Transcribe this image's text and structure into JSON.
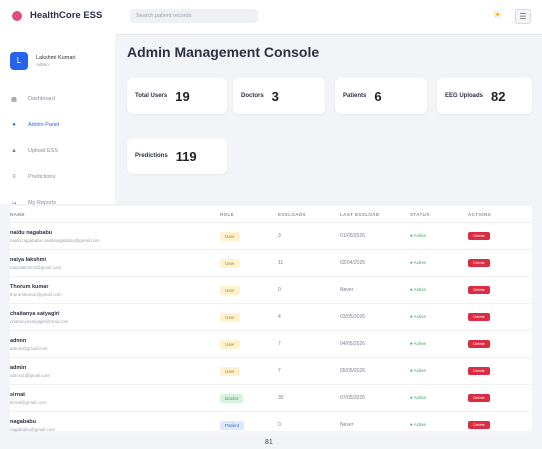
{
  "app": {
    "brand": "HealthCore ESS"
  },
  "search": {
    "placeholder": "Search patient records"
  },
  "user": {
    "initial": "L",
    "name": "Lakshmi Kumari",
    "role": "Admin"
  },
  "sidebar": {
    "items": [
      {
        "icon": "chart-icon",
        "label": "Dashboard"
      },
      {
        "icon": "admin-icon",
        "label": "Admin Panel",
        "active": true
      },
      {
        "icon": "upload-icon",
        "label": "Upload ESS"
      },
      {
        "icon": "predictions-icon",
        "label": "Predictions"
      },
      {
        "icon": "logout-icon",
        "label": "My Reports"
      }
    ]
  },
  "console": {
    "title": "Admin Management Console",
    "stats": [
      {
        "label": "Total Users",
        "value": "19"
      },
      {
        "label": "Doctors",
        "value": "3"
      },
      {
        "label": "Patients",
        "value": "6"
      },
      {
        "label": "EEG Uploads",
        "value": "82"
      },
      {
        "label": "Predictions",
        "value": "119"
      }
    ]
  },
  "table": {
    "headers": [
      "NAME",
      "ROLE",
      "ESSLOADS",
      "LAST ESSLOAD",
      "STATUS",
      "ACTIONS"
    ],
    "rows": [
      {
        "name": "naidu nagababu",
        "email": "naidu.nagababu.naidunagababu@gmail.com",
        "role": "User",
        "role_type": "user",
        "uploads": "3",
        "last": "01/05/2026",
        "status": "● Active",
        "action": "Delete"
      },
      {
        "name": "naiya lakshmi",
        "email": "naiyalakshmi@gmail.com",
        "role": "User",
        "role_type": "user",
        "uploads": "11",
        "last": "02/04/2026",
        "status": "● Active",
        "action": "Delete"
      },
      {
        "name": "Thorum kumar",
        "email": "thorumkumar@gmail.com",
        "role": "User",
        "role_type": "user",
        "uploads": "0",
        "last": "Never",
        "status": "● Active",
        "action": "Delete"
      },
      {
        "name": "chaitanya satyagiri",
        "email": "chaitanyasatyagiri@mail.com",
        "role": "User",
        "role_type": "user",
        "uploads": "4",
        "last": "03/05/2026",
        "status": "● Active",
        "action": "Delete"
      },
      {
        "name": "admin",
        "email": "admin@gmail.com",
        "role": "User",
        "role_type": "user",
        "uploads": "7",
        "last": "04/05/2026",
        "status": "● Active",
        "action": "Delete"
      },
      {
        "name": "admin",
        "email": "admin1@gmail.com",
        "role": "User",
        "role_type": "user",
        "uploads": "7",
        "last": "05/05/2026",
        "status": "● Active",
        "action": "Delete"
      },
      {
        "name": "sirnat",
        "email": "sirnat@gmail.com",
        "role": "Doctor",
        "role_type": "doctor",
        "uploads": "30",
        "last": "07/05/2026",
        "status": "● Active",
        "action": "Delete"
      },
      {
        "name": "nagababu",
        "email": "nagababu@gmail.com",
        "role": "Patient",
        "role_type": "patient",
        "uploads": "0",
        "last": "Never",
        "status": "● Active",
        "action": "Delete"
      }
    ]
  },
  "pager": {
    "label": "81"
  }
}
